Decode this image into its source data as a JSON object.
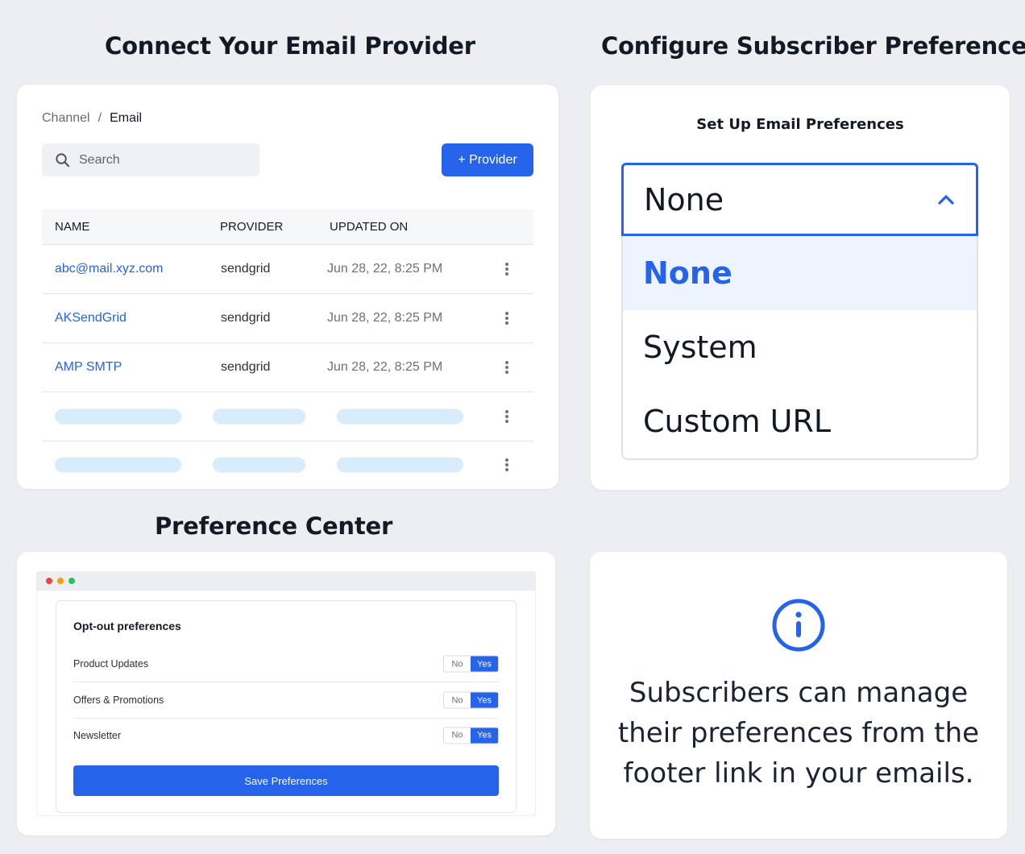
{
  "sections": {
    "connect_title": "Connect Your Email Provider",
    "configure_title": "Configure Subscriber Preferences",
    "preference_center_title": "Preference Center"
  },
  "providers_panel": {
    "breadcrumb": {
      "root": "Channel",
      "separator": "/",
      "current": "Email"
    },
    "search": {
      "placeholder": "Search",
      "icon": "search-icon"
    },
    "add_provider_label": "+ Provider",
    "table": {
      "columns": [
        "NAME",
        "PROVIDER",
        "UPDATED ON"
      ],
      "rows": [
        {
          "name": "abc@mail.xyz.com",
          "provider": "sendgrid",
          "updated_on": "Jun 28, 22, 8:25 PM"
        },
        {
          "name": "AKSendGrid",
          "provider": "sendgrid",
          "updated_on": "Jun 28, 22, 8:25 PM"
        },
        {
          "name": "AMP SMTP",
          "provider": "sendgrid",
          "updated_on": "Jun 28, 22, 8:25 PM"
        }
      ],
      "placeholder_rows": 2
    }
  },
  "preferences_panel": {
    "heading": "Set Up Email Preferences",
    "selected_value": "None",
    "options": [
      "None",
      "System",
      "Custom URL"
    ],
    "chevron_icon": "chevron-up-icon"
  },
  "preference_center": {
    "title": "Opt-out preferences",
    "rows": [
      {
        "label": "Product Updates",
        "no": "No",
        "yes": "Yes"
      },
      {
        "label": "Offers & Promotions",
        "no": "No",
        "yes": "Yes"
      },
      {
        "label": "Newsletter",
        "no": "No",
        "yes": "Yes"
      }
    ],
    "save_label": "Save Preferences"
  },
  "info_panel": {
    "icon": "info-icon",
    "lines": [
      "Subscribers can manage",
      "their preferences from the",
      "footer link in your emails."
    ]
  },
  "colors": {
    "accent": "#2563eb",
    "background": "#edeef1",
    "skeleton": "#d8ecfb",
    "dot_red": "#ef4444",
    "dot_yellow": "#f59e0b",
    "dot_green": "#22c55e"
  }
}
